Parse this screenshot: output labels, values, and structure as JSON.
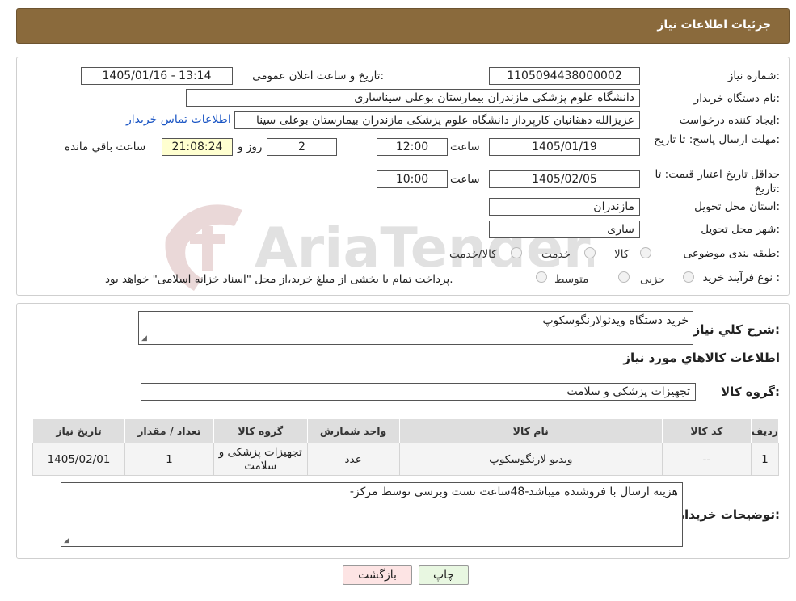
{
  "header": {
    "title": "جزئیات اطلاعات نیاز"
  },
  "watermark": {
    "text": "AriaTender.neT"
  },
  "fields": {
    "need_number_label": "شماره نیاز:",
    "need_number": "1105094438000002",
    "announce_label": "تاریخ و ساعت اعلان عمومی:",
    "announce_value": "1405/01/16 - 13:14",
    "buyer_org_label": "نام دستگاه خریدار:",
    "buyer_org": "دانشگاه علوم پزشکی مازندران بیمارستان بوعلی سیناساری",
    "creator_label": "ایجاد کننده درخواست:",
    "creator": "عزیزالله دهقانیان کارپرداز دانشگاه علوم پزشکی مازندران بیمارستان بوعلی سینا",
    "contact_link": "اطلاعات تماس خریدار",
    "deadline_label": "مهلت ارسال پاسخ: تا تاریخ:",
    "deadline_date": "1405/01/19",
    "time_label": "ساعت",
    "deadline_time": "12:00",
    "days_value": "2",
    "days_label": "روز و",
    "remaining_time": "21:08:24",
    "remaining_label": "ساعت باقي مانده",
    "validity_label": "حداقل تاریخ اعتبار قیمت: تا تاریخ:",
    "validity_date": "1405/02/05",
    "validity_time": "10:00",
    "province_label": "استان محل تحویل:",
    "province": "مازندران",
    "city_label": "شهر محل تحویل:",
    "city": "ساری",
    "category_label": "طبقه بندی موضوعی:",
    "category_options": [
      "کالا",
      "خدمت",
      "کالا/خدمت"
    ],
    "process_label": "نوع فرآیند خرید :",
    "process_options": [
      "جزیی",
      "متوسط"
    ],
    "process_note": "پرداخت تمام یا بخشی از مبلغ خرید،از محل \"اسناد خزانه اسلامی\" خواهد بود."
  },
  "need": {
    "desc_label": "شرح کلي نياز:",
    "desc": "خرید دستگاه ویدئولارنگوسکوپ",
    "goods_info_title": "اطلاعات كالاهاي مورد نياز",
    "group_label": "گروه کالا:",
    "group": "تجهیزات پزشکی و سلامت"
  },
  "table": {
    "headers": [
      "ردیف",
      "کد کالا",
      "نام کالا",
      "واحد شمارش",
      "گروه کالا",
      "تعداد / مقدار",
      "تاریخ نیاز"
    ],
    "rows": [
      [
        "1",
        "--",
        "ویدیو لارنگوسکوپ",
        "عدد",
        "تجهیزات پزشکی و سلامت",
        "1",
        "1405/02/01"
      ]
    ]
  },
  "buyer_notes": {
    "label": "توضیحات خریدار:",
    "text": "هزینه ارسال با فروشنده میباشد-48ساعت تست وبرسی توسط مرکز-"
  },
  "buttons": {
    "print": "چاپ",
    "back": "بازگشت"
  },
  "colors": {
    "header": "#8a6a3c",
    "back_button": "#fde4e4",
    "print_button": "#e8f7e1",
    "link": "#1a55c4"
  }
}
